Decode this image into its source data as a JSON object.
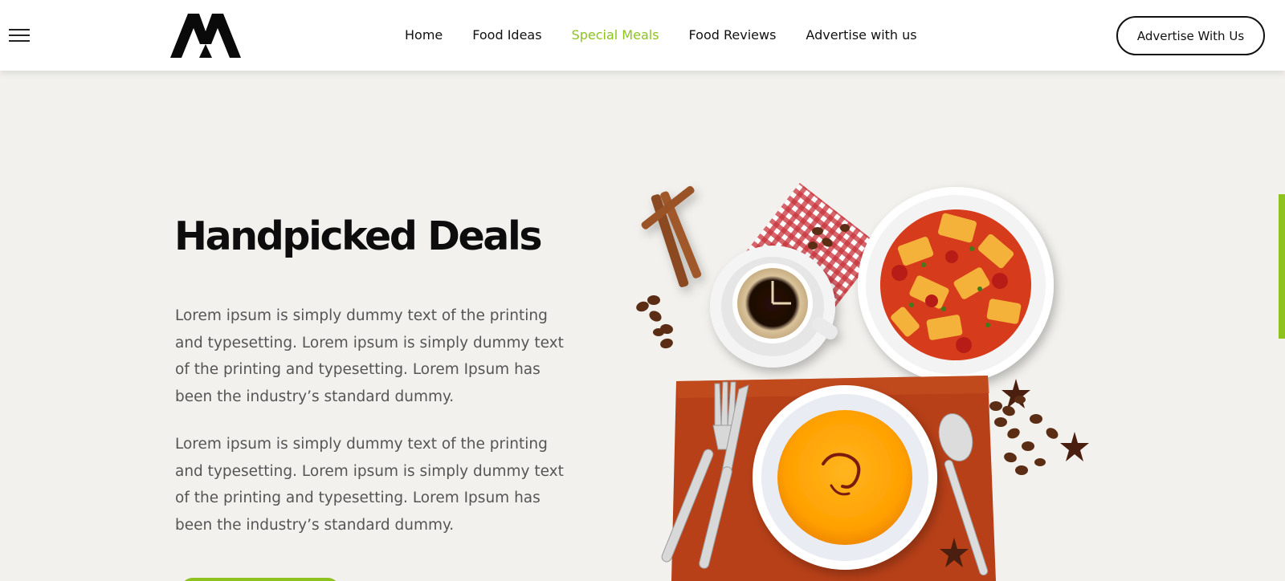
{
  "header": {
    "nav": [
      {
        "label": "Home",
        "active": false
      },
      {
        "label": "Food Ideas",
        "active": false
      },
      {
        "label": "Special Meals",
        "active": true
      },
      {
        "label": "Food Reviews",
        "active": false
      },
      {
        "label": "Advertise with us",
        "active": false
      }
    ],
    "cta_label": "Advertise With Us"
  },
  "hero": {
    "title": "Handpicked Deals",
    "paragraphs": [
      "Lorem ipsum is simply dummy text of the printing and typesetting. Lorem ipsum is simply dummy text of the printing and typesetting. Lorem Ipsum has been the industry’s standard dummy.",
      "Lorem ipsum is simply dummy text of the printing and typesetting. Lorem ipsum is simply dummy text of the printing and typesetting. Lorem Ipsum has been the industry’s standard dummy."
    ]
  },
  "icons": {
    "menu": "hamburger-menu-icon",
    "logo": "brand-logo"
  },
  "colors": {
    "accent": "#8dc21f",
    "background": "#f2f1ed",
    "text_dark": "#0d0d0d",
    "text_body": "#555555"
  }
}
